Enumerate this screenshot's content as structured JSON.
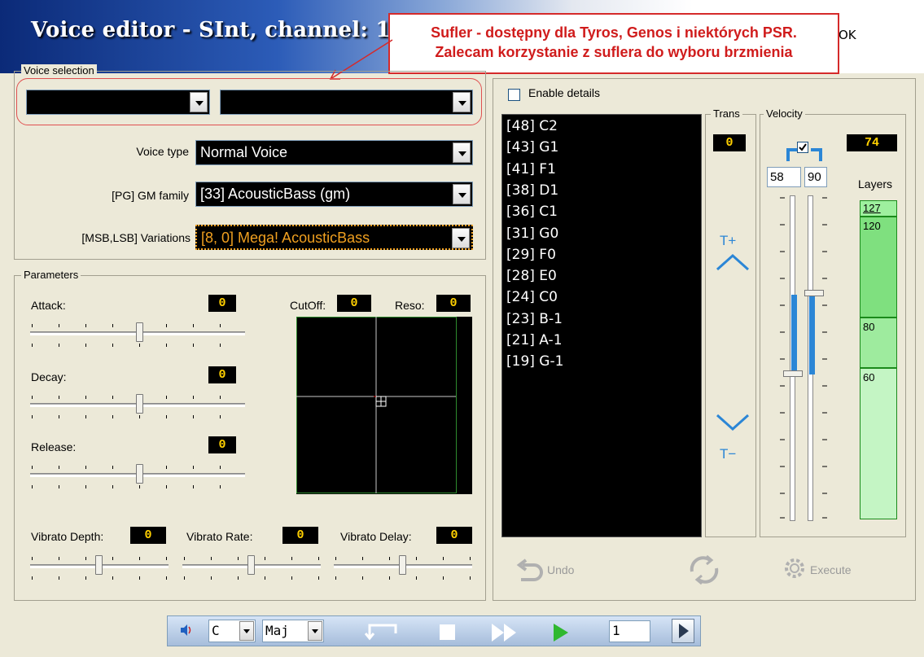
{
  "window": {
    "title": "Voice editor - SInt, channel: 11",
    "ok_label": "OK"
  },
  "callout": {
    "line1": "Sufler - dostępny dla Tyros, Genos i niektórych PSR.",
    "line2": "Zalecam korzystanie z suflera do wyboru brzmienia"
  },
  "voice_selection": {
    "group_label": "Voice selection",
    "combo1_value": "",
    "combo2_value": "",
    "voice_type_label": "Voice type",
    "voice_type_value": "Normal Voice",
    "gm_family_label": "[PG] GM family",
    "gm_family_value": "[33] AcousticBass (gm)",
    "variations_label": "[MSB,LSB] Variations",
    "variations_value": "[8, 0] Mega! AcousticBass"
  },
  "parameters": {
    "group_label": "Parameters",
    "attack_label": "Attack:",
    "attack_value": "0",
    "decay_label": "Decay:",
    "decay_value": "0",
    "release_label": "Release:",
    "release_value": "0",
    "cutoff_label": "CutOff:",
    "cutoff_value": "0",
    "reso_label": "Reso:",
    "reso_value": "0",
    "vibrato_depth_label": "Vibrato Depth:",
    "vibrato_depth_value": "0",
    "vibrato_rate_label": "Vibrato Rate:",
    "vibrato_rate_value": "0",
    "vibrato_delay_label": "Vibrato Delay:",
    "vibrato_delay_value": "0"
  },
  "details": {
    "enable_details_label": "Enable details",
    "enable_details_checked": false,
    "notes": [
      "[48] C2",
      "[43] G1",
      "[41] F1",
      "[38] D1",
      "[36] C1",
      "[31] G0",
      "[29] F0",
      "[28] E0",
      "[24] C0",
      "[23] B-1",
      "[21] A-1",
      "[19] G-1"
    ],
    "trans_label": "Trans",
    "trans_value": "0",
    "trans_up_label": "T+",
    "trans_down_label": "T−",
    "velocity_label": "Velocity",
    "velocity_value": "74",
    "velocity_low": "58",
    "velocity_high": "90",
    "velocity_link_checked": true,
    "layers_label": "Layers",
    "layers": [
      "127",
      "120",
      "80",
      "60"
    ],
    "undo_label": "Undo",
    "execute_label": "Execute"
  },
  "toolbar": {
    "key_value": "C",
    "scale_value": "Maj",
    "count_value": "1"
  },
  "colors": {
    "value_text": "#ffd000",
    "accent_blue": "#2b86d6",
    "callout_red": "#d01c1c",
    "layer_green": "#7fe07f"
  }
}
